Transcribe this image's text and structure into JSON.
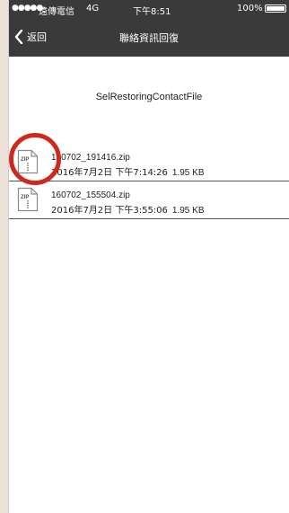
{
  "status_bar": {
    "signal": "●●●●●",
    "carrier": "遠傳電信",
    "network": "4G",
    "time": "下午8:51",
    "battery_pct": "100%"
  },
  "nav": {
    "back_label": "返回",
    "title": "聯絡資訊回復"
  },
  "folder": {
    "name": "SelRestoringContactFile"
  },
  "files": [
    {
      "icon": "zip-file-icon",
      "icon_label": "ZIP",
      "name": "160702_191416.zip",
      "date": "2016年7月2日 下午7:14:26",
      "size": "1.95 KB"
    },
    {
      "icon": "zip-file-icon",
      "icon_label": "ZIP",
      "name": "160702_155504.zip",
      "date": "2016年7月2日 下午3:55:06",
      "size": "1.95 KB"
    }
  ],
  "colors": {
    "bars": "#3a3a3a",
    "highlight": "#cc2a1e",
    "background": "#ece1d7"
  }
}
